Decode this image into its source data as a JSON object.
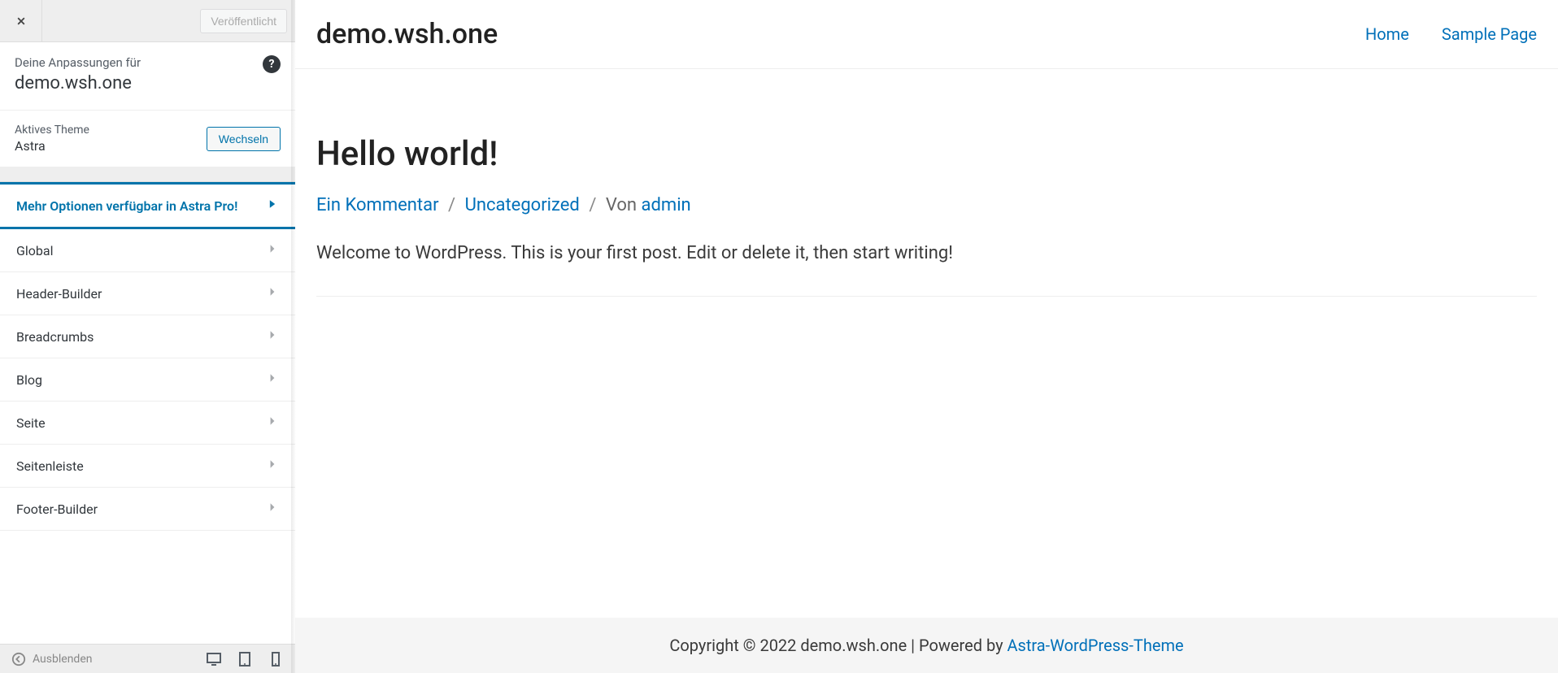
{
  "sidebar": {
    "publish_label": "Veröffentlicht",
    "customizing_label": "Deine Anpassungen für",
    "site_name": "demo.wsh.one",
    "active_theme_label": "Aktives Theme",
    "theme_name": "Astra",
    "change_theme_label": "Wechseln",
    "promo_label": "Mehr Optionen verfügbar in Astra Pro!",
    "items": [
      {
        "label": "Global"
      },
      {
        "label": "Header-Builder"
      },
      {
        "label": "Breadcrumbs"
      },
      {
        "label": "Blog"
      },
      {
        "label": "Seite"
      },
      {
        "label": "Seitenleiste"
      },
      {
        "label": "Footer-Builder"
      }
    ],
    "collapse_label": "Ausblenden"
  },
  "preview": {
    "site_title": "demo.wsh.one",
    "nav": [
      {
        "label": "Home"
      },
      {
        "label": "Sample Page"
      }
    ],
    "post": {
      "title": "Hello world!",
      "meta_comments": "Ein Kommentar",
      "meta_category": "Uncategorized",
      "meta_author_prefix": "Von ",
      "meta_author": "admin",
      "content": "Welcome to WordPress. This is your first post. Edit or delete it, then start writing!"
    },
    "footer": {
      "copyright": "Copyright © 2022 demo.wsh.one | Powered by ",
      "theme_link": "Astra-WordPress-Theme"
    }
  }
}
